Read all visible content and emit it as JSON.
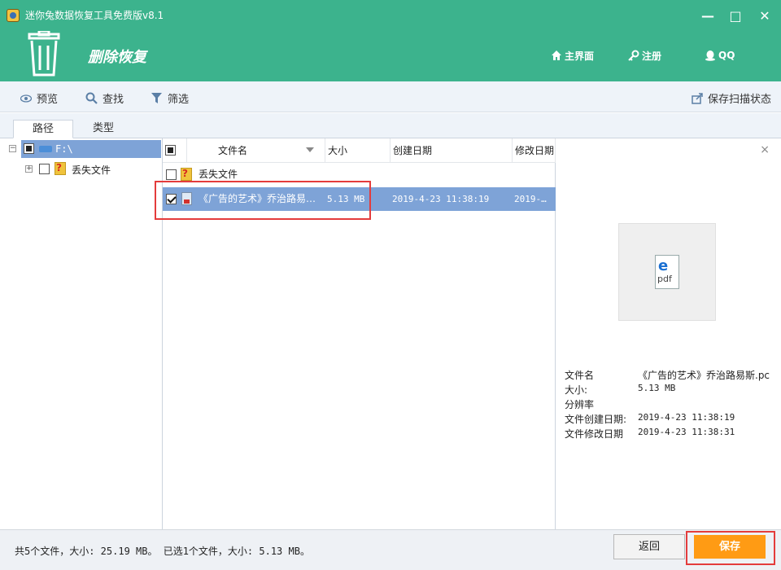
{
  "window": {
    "title": "迷你兔数据恢复工具免费版v8.1",
    "controls": {
      "minimize": "—",
      "maximize": "□",
      "close": "✕"
    }
  },
  "header": {
    "page_title": "删除恢复",
    "nav": {
      "home": "主界面",
      "register": "注册",
      "qq": "QQ"
    },
    "colors": {
      "header_bg": "#3cb38d",
      "accent": "#ff9b14",
      "highlight": "#e43c3c",
      "selected_row": "#7ea3d7"
    }
  },
  "toolbar": {
    "preview": "预览",
    "search": "查找",
    "filter": "筛选",
    "save_scan_state": "保存扫描状态"
  },
  "tabs": {
    "path": "路径",
    "type": "类型"
  },
  "tree": {
    "root_label": "F:\\",
    "child_label": "丢失文件"
  },
  "file_list": {
    "columns": {
      "name": "文件名",
      "size": "大小",
      "created": "创建日期",
      "modified": "修改日期"
    },
    "rows": [
      {
        "name": "丢失文件",
        "size": "",
        "created": "",
        "modified": "",
        "checked": false
      },
      {
        "name": "《广告的艺术》乔治路易…",
        "size": "5.13 MB",
        "created": "2019-4-23 11:38:19",
        "modified": "2019-…",
        "checked": true
      }
    ]
  },
  "preview": {
    "close": "×",
    "thumb_label": "pdf",
    "thumb_glyph": "e",
    "info": {
      "file_name_label": "文件名",
      "file_name_value": "《广告的艺术》乔治路易斯.pc",
      "size_label": "大小:",
      "size_value": "5.13 MB",
      "resolution_label": "分辨率",
      "resolution_value": "",
      "created_label": "文件创建日期:",
      "created_value": "2019-4-23 11:38:19",
      "modified_label": "文件修改日期",
      "modified_value": "2019-4-23 11:38:31"
    }
  },
  "status": {
    "summary": "共5个文件，大小: 25.19 MB。 已选1个文件，大小: 5.13 MB。",
    "back_label": "返回",
    "save_label": "保存"
  }
}
